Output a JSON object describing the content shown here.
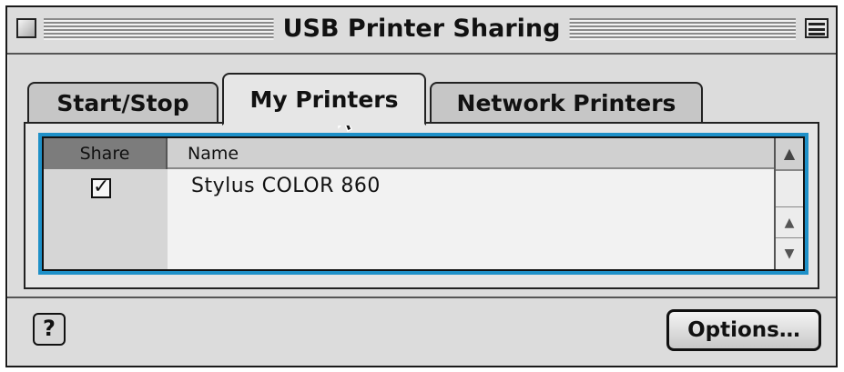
{
  "window": {
    "title": "USB Printer Sharing"
  },
  "tabs": [
    {
      "label": "Start/Stop",
      "active": false
    },
    {
      "label": "My Printers",
      "active": true
    },
    {
      "label": "Network Printers",
      "active": false
    }
  ],
  "printer_list": {
    "columns": {
      "share": "Share",
      "name": "Name"
    },
    "rows": [
      {
        "share": true,
        "name": "Stylus COLOR 860"
      }
    ]
  },
  "icons": {
    "close": "close-box-icon",
    "collapse": "collapse-box-icon",
    "help": "help-icon",
    "sort": "sort-indicator-icon",
    "scroll_up": "arrow-up-icon",
    "scroll_down": "arrow-down-icon",
    "cursor": "pointer-cursor-icon"
  },
  "help_button": {
    "glyph": "?"
  },
  "options_button": {
    "label": "Options…"
  },
  "colors": {
    "focus_ring": "#1e90c8",
    "window_bg": "#dcdcdc"
  }
}
